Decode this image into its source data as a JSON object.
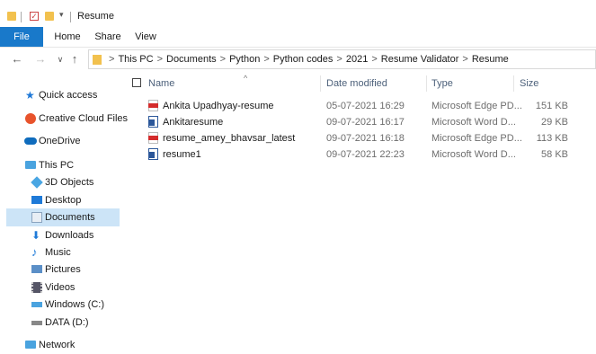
{
  "window": {
    "title": "Resume"
  },
  "ribbon": {
    "tabs": [
      "File",
      "Home",
      "Share",
      "View"
    ]
  },
  "address": {
    "crumbs": [
      "This PC",
      "Documents",
      "Python",
      "Python codes",
      "2021",
      "Resume Validator",
      "Resume"
    ],
    "separator": ">"
  },
  "sidebar": {
    "items": [
      {
        "label": "Quick access",
        "icon": "star-icon",
        "color": "#1e78d7"
      },
      {
        "label": "Creative Cloud Files",
        "icon": "creative-cloud-icon",
        "color": "#e8532c"
      },
      {
        "label": "OneDrive",
        "icon": "cloud-icon",
        "color": "#0f6cbd"
      },
      {
        "label": "This PC",
        "icon": "computer-icon",
        "color": "#4aa3df"
      },
      {
        "label": "3D Objects",
        "icon": "cube-icon",
        "color": "#49a6e3"
      },
      {
        "label": "Desktop",
        "icon": "desktop-icon",
        "color": "#1e7ad8"
      },
      {
        "label": "Documents",
        "icon": "document-icon",
        "color": "#8aa4bf"
      },
      {
        "label": "Downloads",
        "icon": "download-icon",
        "color": "#1e7ad8"
      },
      {
        "label": "Music",
        "icon": "music-note-icon",
        "color": "#1e7ad8"
      },
      {
        "label": "Pictures",
        "icon": "picture-icon",
        "color": "#5b8fc7"
      },
      {
        "label": "Videos",
        "icon": "film-icon",
        "color": "#556"
      },
      {
        "label": "Windows (C:)",
        "icon": "drive-icon",
        "color": "#4aa3df"
      },
      {
        "label": "DATA (D:)",
        "icon": "drive-icon",
        "color": "#888"
      },
      {
        "label": "Network",
        "icon": "network-icon",
        "color": "#4aa3df"
      }
    ],
    "selected": "Documents"
  },
  "list": {
    "columns": {
      "name": "Name",
      "date": "Date modified",
      "type": "Type",
      "size": "Size"
    },
    "rows": [
      {
        "name": "Ankita Upadhyay-resume",
        "date": "05-07-2021 16:29",
        "type": "Microsoft Edge PD...",
        "size": "151 KB",
        "icon": "pdf-file-icon"
      },
      {
        "name": "Ankitaresume",
        "date": "09-07-2021 16:17",
        "type": "Microsoft Word D...",
        "size": "29 KB",
        "icon": "word-file-icon"
      },
      {
        "name": "resume_amey_bhavsar_latest",
        "date": "09-07-2021 16:18",
        "type": "Microsoft Edge PD...",
        "size": "113 KB",
        "icon": "pdf-file-icon"
      },
      {
        "name": "resume1",
        "date": "09-07-2021 22:23",
        "type": "Microsoft Word D...",
        "size": "58 KB",
        "icon": "word-file-icon"
      }
    ]
  }
}
